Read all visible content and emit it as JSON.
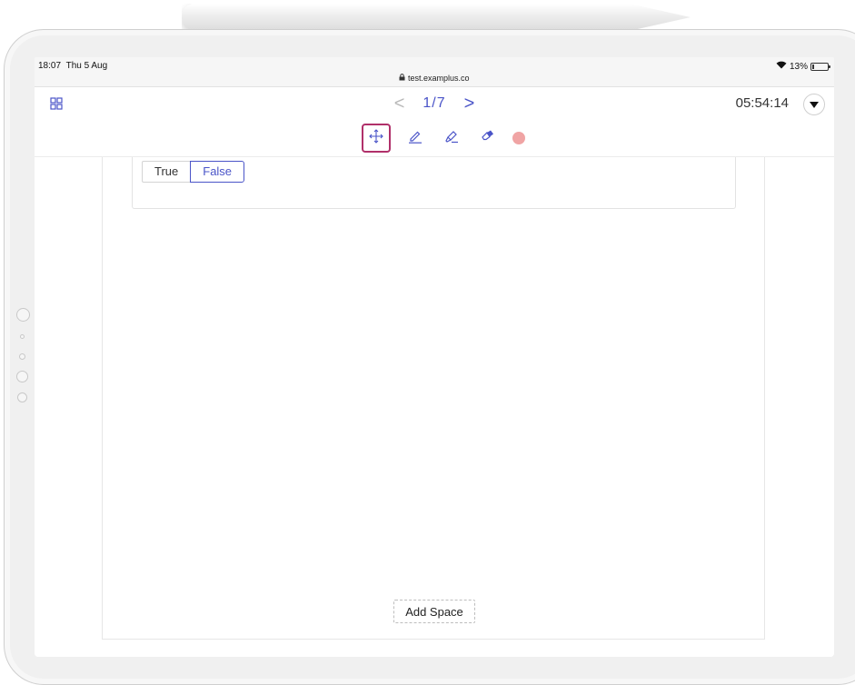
{
  "status_bar": {
    "time": "18:07",
    "date": "Thu 5 Aug",
    "url": "test.examplus.co",
    "battery": "13%",
    "battery_level": 0.13,
    "wifi_icon": "wifi-icon",
    "lock_icon": "lock-icon"
  },
  "header": {
    "grid_icon": "grid-icon",
    "prev_label": "<",
    "page_indicator": "1/7",
    "next_label": ">",
    "timer": "05:54:14",
    "menu_icon": "caret-down-icon"
  },
  "toolbar": {
    "tools": [
      {
        "name": "move",
        "icon": "move-icon",
        "active": true
      },
      {
        "name": "pen",
        "icon": "pen-icon",
        "active": false
      },
      {
        "name": "highlighter",
        "icon": "highlighter-icon",
        "active": false
      },
      {
        "name": "eraser",
        "icon": "eraser-icon",
        "active": false
      }
    ],
    "color": "#f0a4a4",
    "accent": "#4a54c8",
    "active_outline": "#b0306a"
  },
  "question": {
    "options": [
      "True",
      "False"
    ],
    "selected": "False"
  },
  "add_space_label": "Add Space"
}
